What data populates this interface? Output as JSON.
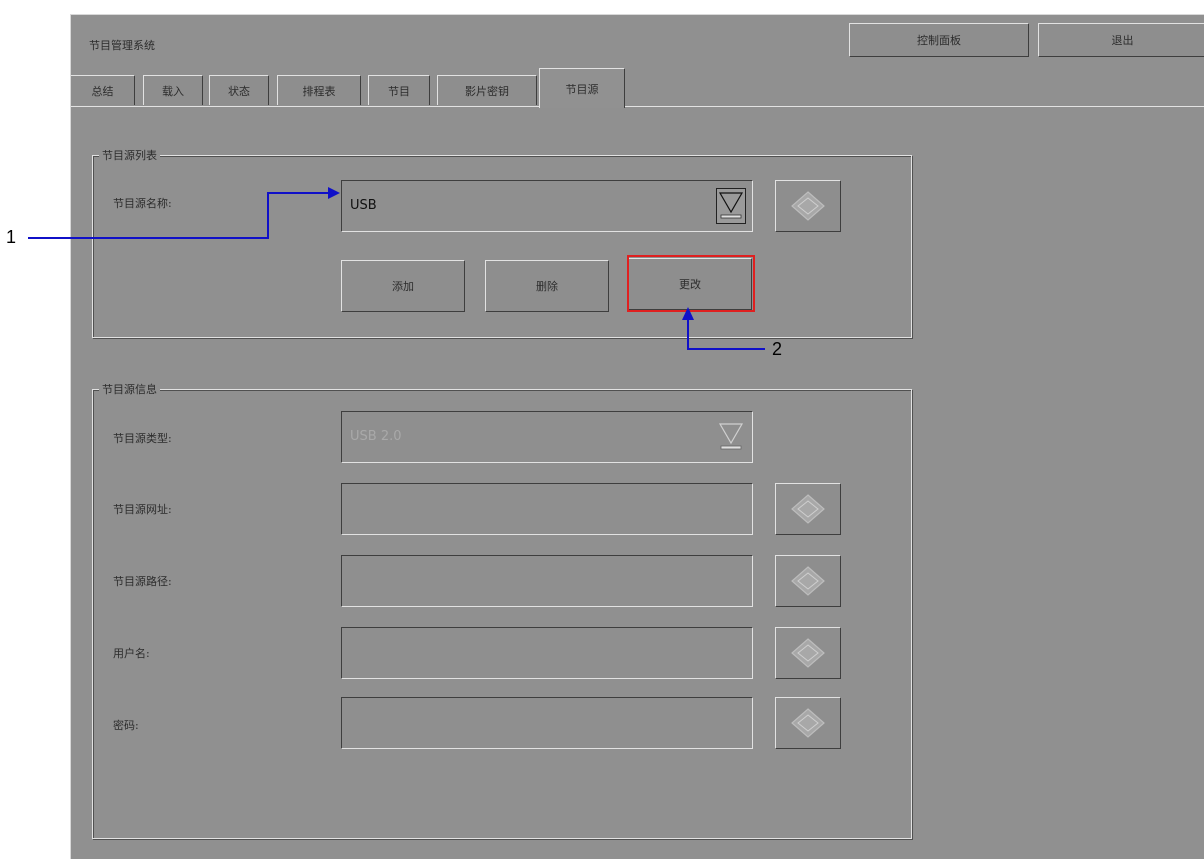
{
  "app": {
    "title": "节目管理系统",
    "control_panel_label": "控制面板",
    "exit_label": "退出"
  },
  "tabs": [
    {
      "label": "总结"
    },
    {
      "label": "载入"
    },
    {
      "label": "状态"
    },
    {
      "label": "排程表"
    },
    {
      "label": "节目"
    },
    {
      "label": "影片密钥"
    },
    {
      "label": "节目源",
      "active": true
    }
  ],
  "source_list": {
    "group_title": "节目源列表",
    "name_label": "节目源名称:",
    "name_value": "USB",
    "add_label": "添加",
    "delete_label": "删除",
    "modify_label": "更改"
  },
  "source_info": {
    "group_title": "节目源信息",
    "type_label": "节目源类型:",
    "type_value": "USB 2.0",
    "address_label": "节目源网址:",
    "path_label": "节目源路径:",
    "username_label": "用户名:",
    "password_label": "密码:"
  },
  "annotations": {
    "callout_1": "1",
    "callout_2": "2",
    "arrow_color": "#1010c8",
    "highlight_color": "#e02020"
  },
  "colors": {
    "panel_bg": "#909090",
    "bevel_light": "#e2e2e2",
    "bevel_dark": "#3e3e3e"
  }
}
